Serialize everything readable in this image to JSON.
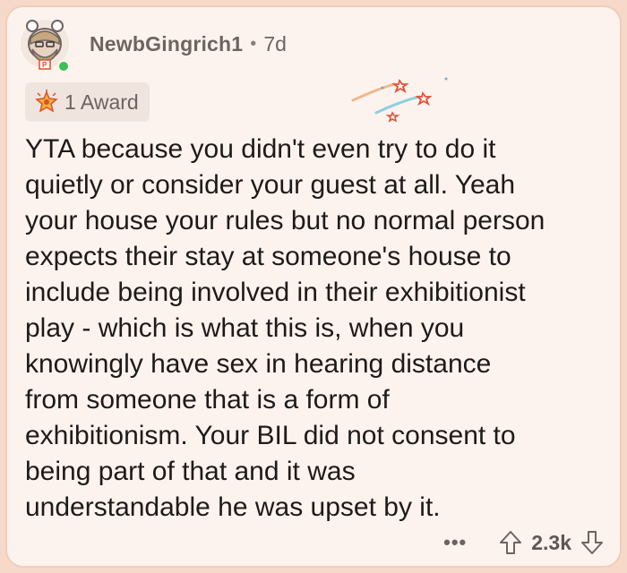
{
  "comment": {
    "username": "NewbGingrich1",
    "separator": "•",
    "age": "7d",
    "award_label": "1 Award",
    "lines": [
      "YTA because you didn't even try to do it",
      "quietly or consider your guest at all. Yeah",
      "your house your rules but no normal person",
      "expects their stay at someone's house to",
      "include being involved in their exhibitionist",
      "play - which is what this is, when you",
      "knowingly have sex in hearing distance",
      "from someone that is a form of",
      "exhibitionism. Your BIL did not consent to",
      "being part of that and it was",
      "understandable he was upset by it."
    ],
    "more_label": "•••",
    "score": "2.3k"
  },
  "icons": {
    "avatar": "snoo-avatar-icon",
    "online": "online-status-icon",
    "award": "award-star-icon",
    "sparkles": "shooting-stars-icon",
    "upvote": "upvote-arrow-icon",
    "downvote": "downvote-arrow-icon"
  },
  "colors": {
    "background": "#f6d9c9",
    "card": "#fdf3ee",
    "online": "#3fbf57",
    "text": "#1e1a19",
    "muted": "#6d6461"
  }
}
